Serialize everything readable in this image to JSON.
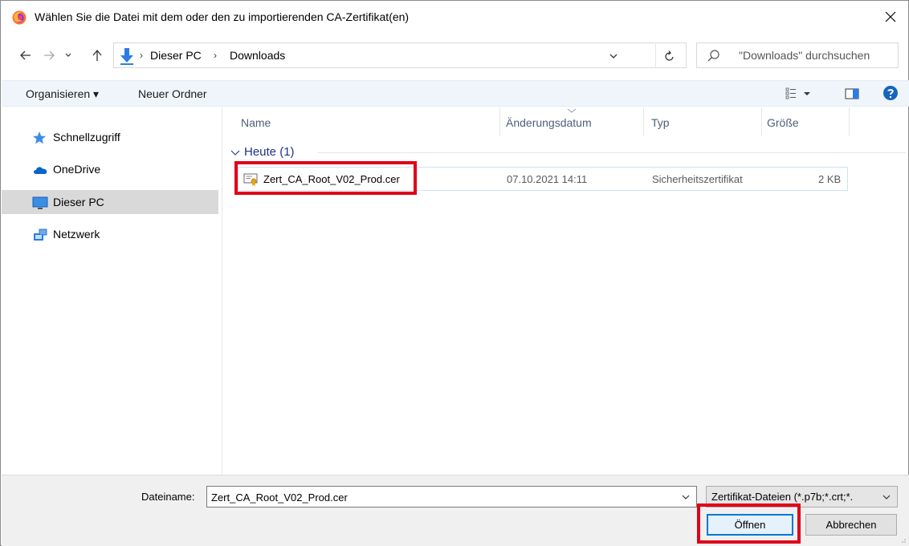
{
  "window": {
    "title": "Wählen Sie die Datei mit dem oder den zu importierenden CA-Zertifikat(en)",
    "close_glyph": "✕",
    "logo_icon": "firefox-icon"
  },
  "navigation": {
    "back_icon": "arrow-left-icon",
    "forward_icon": "arrow-right-icon",
    "recent_icon": "chevron-down-icon",
    "up_icon": "arrow-up-icon",
    "breadcrumbs": [
      "Dieser PC",
      "Downloads"
    ],
    "breadcrumb_separator": "›",
    "refresh_icon": "refresh-icon",
    "search_placeholder": "\"Downloads\" durchsuchen"
  },
  "toolbar": {
    "organize_label": "Organisieren ▾",
    "new_folder_label": "Neuer Ordner",
    "view_icon": "view-options-icon",
    "preview_icon": "preview-pane-icon",
    "help_icon": "help-icon"
  },
  "sidebar": {
    "items": [
      {
        "label": "Schnellzugriff",
        "icon": "star-icon",
        "selected": false
      },
      {
        "label": "OneDrive",
        "icon": "cloud-icon",
        "selected": false
      },
      {
        "label": "Dieser PC",
        "icon": "monitor-icon",
        "selected": true
      },
      {
        "label": "Netzwerk",
        "icon": "network-icon",
        "selected": false
      }
    ]
  },
  "file_list": {
    "columns": [
      "Name",
      "Änderungsdatum",
      "Typ",
      "Größe"
    ],
    "group_header": "Heute (1)",
    "rows": [
      {
        "name": "Zert_CA_Root_V02_Prod.cer",
        "modified": "07.10.2021 14:11",
        "type": "Sicherheitszertifikat",
        "size": "2 KB",
        "icon": "certificate-icon"
      }
    ]
  },
  "footer": {
    "filename_label": "Dateiname:",
    "filename_value": "Zert_CA_Root_V02_Prod.cer",
    "filter_value": "Zertifikat-Dateien (*.p7b;*.crt;*.",
    "open_label": "Öffnen",
    "cancel_label": "Abbrechen"
  },
  "colors": {
    "highlight": "#e0001a",
    "toolbar_bg": "#f0f5fb",
    "accent": "#0078d7",
    "group_header": "#1e3287"
  }
}
